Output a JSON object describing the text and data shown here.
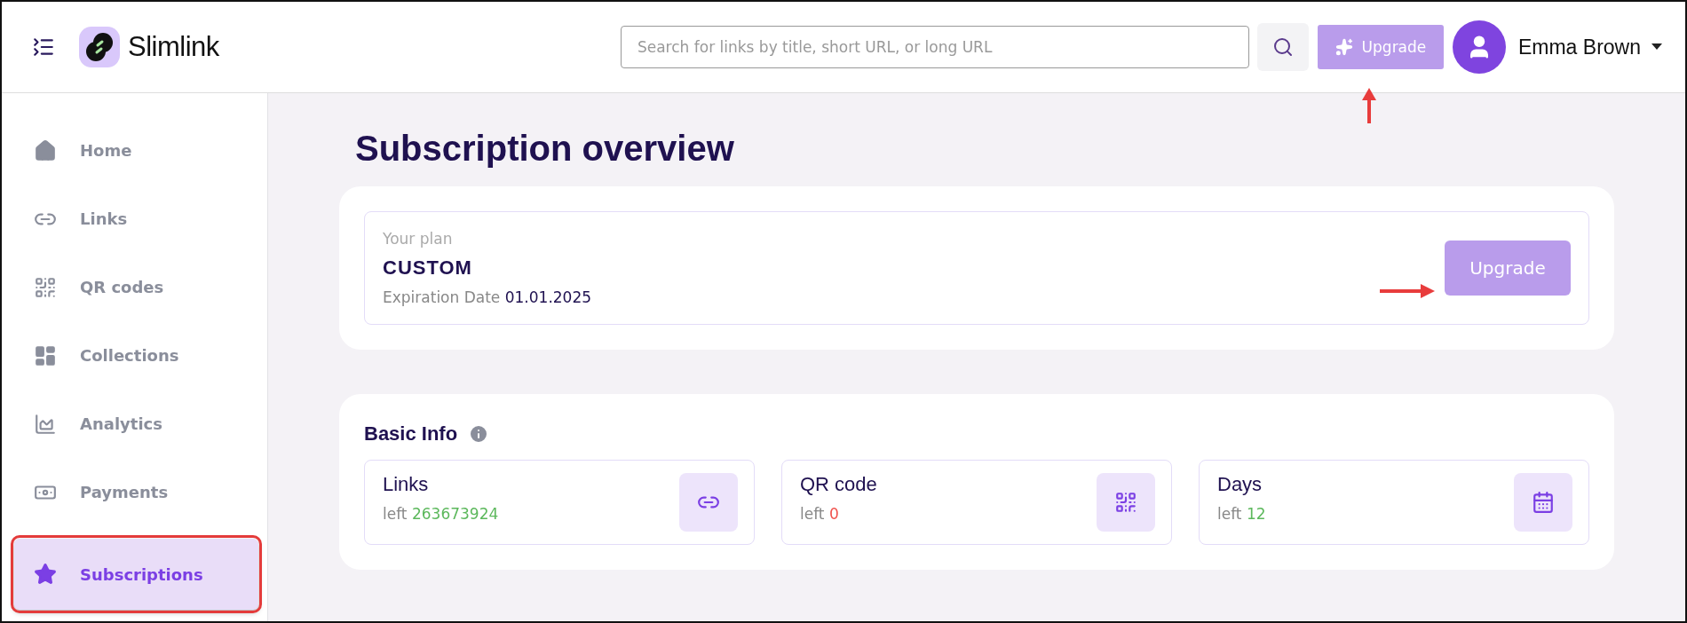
{
  "header": {
    "brand": "Slimlink",
    "search": {
      "placeholder": "Search for links by title, short URL, or long URL"
    },
    "upgrade_button": "Upgrade",
    "user_name": "Emma Brown"
  },
  "sidebar": {
    "items": [
      {
        "label": "Home",
        "kind": "home",
        "selected": false
      },
      {
        "label": "Links",
        "kind": "link",
        "selected": false
      },
      {
        "label": "QR codes",
        "kind": "qr",
        "selected": false
      },
      {
        "label": "Collections",
        "kind": "collections",
        "selected": false
      },
      {
        "label": "Analytics",
        "kind": "analytics",
        "selected": false
      },
      {
        "label": "Payments",
        "kind": "payments",
        "selected": false
      },
      {
        "label": "Subscriptions",
        "kind": "star",
        "selected": true
      }
    ]
  },
  "page_title": "Subscription overview",
  "plan": {
    "caption": "Your plan",
    "name": "CUSTOM",
    "expiration_label": "Expiration Date",
    "expiration_date": "01.01.2025",
    "button": "Upgrade"
  },
  "basic_info": {
    "title": "Basic Info",
    "stats": [
      {
        "name": "Links",
        "left_label": "left",
        "value": "263673924",
        "color": "#5cb85c",
        "kind": "link"
      },
      {
        "name": "QR code",
        "left_label": "left",
        "value": "0",
        "color": "#f0524d",
        "kind": "qr"
      },
      {
        "name": "Days",
        "left_label": "left",
        "value": "12",
        "color": "#5cb85c",
        "kind": "calendar"
      }
    ]
  }
}
